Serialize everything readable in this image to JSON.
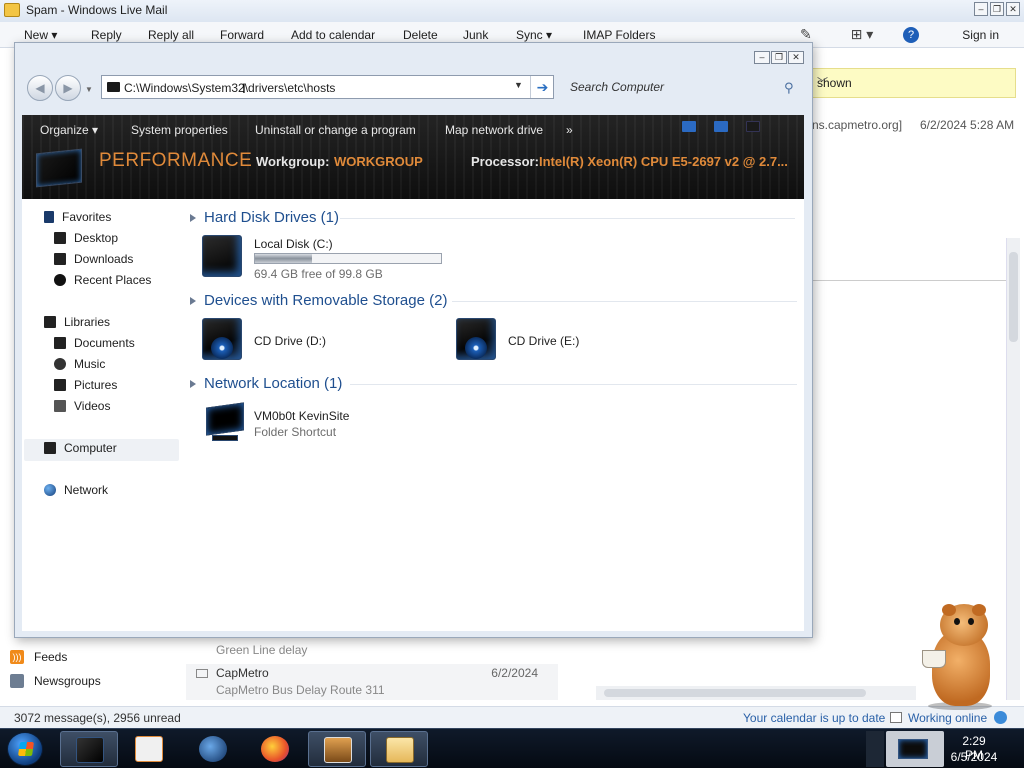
{
  "mail": {
    "title": "Spam - Windows Live Mail",
    "ribbon": [
      "New",
      "Reply",
      "Reply all",
      "Forward",
      "Add to calendar",
      "Delete",
      "Junk",
      "Sync",
      "IMAP Folders"
    ],
    "sign_in": "Sign in",
    "infobar_text": "shown",
    "msg_header_from": "ns.capmetro.org]",
    "msg_header_date": "6/2/2024 5:28 AM",
    "nav_items": [
      "Feeds",
      "Newsgroups"
    ],
    "messages": [
      {
        "subject": "Green Line delay"
      },
      {
        "sender": "CapMetro",
        "subject": "CapMetro Bus Delay Route 311",
        "date": "6/2/2024"
      }
    ],
    "status": {
      "count": "3072 message(s), 2956 unread",
      "calendar": "Your calendar is up to date",
      "online": "Working online"
    }
  },
  "explorer": {
    "address": "C:\\Windows\\System32\\drivers\\etc\\hosts",
    "search_placeholder": "Search Computer",
    "toolbar": [
      "Organize",
      "System properties",
      "Uninstall or change a program",
      "Map network drive",
      "»"
    ],
    "banner": {
      "title": "PERFORMANCE",
      "workgroup_label": "Workgroup:",
      "workgroup_value": "WORKGROUP",
      "processor_label": "Processor:",
      "processor_value": "Intel(R) Xeon(R) CPU E5-2697 v2 @ 2.7..."
    },
    "nav": {
      "favorites": "Favorites",
      "favorites_items": [
        "Desktop",
        "Downloads",
        "Recent Places"
      ],
      "libraries": "Libraries",
      "libraries_items": [
        "Documents",
        "Music",
        "Pictures",
        "Videos"
      ],
      "computer": "Computer",
      "network": "Network"
    },
    "groups": {
      "hdd": "Hard Disk Drives (1)",
      "removable": "Devices with Removable Storage (2)",
      "netloc": "Network Location (1)"
    },
    "drives": {
      "local_name": "Local Disk (C:)",
      "local_free": "69.4 GB free of 99.8 GB",
      "local_used_fraction": 0.305,
      "cd_d": "CD Drive (D:)",
      "cd_e": "CD Drive (E:)",
      "net_name": "VM0b0t KevinSite",
      "net_type": "Folder Shortcut"
    }
  },
  "taskbar": {
    "time": "2:29 PM",
    "date": "6/5/2024",
    "apps": [
      "explorer",
      "media-player",
      "network-globe",
      "firefox",
      "box-game",
      "mail"
    ]
  },
  "colors": {
    "accent_orange": "#e08a3a",
    "group_header_blue": "#1f4f8f",
    "infobar_yellow": "#fdfbc4"
  }
}
